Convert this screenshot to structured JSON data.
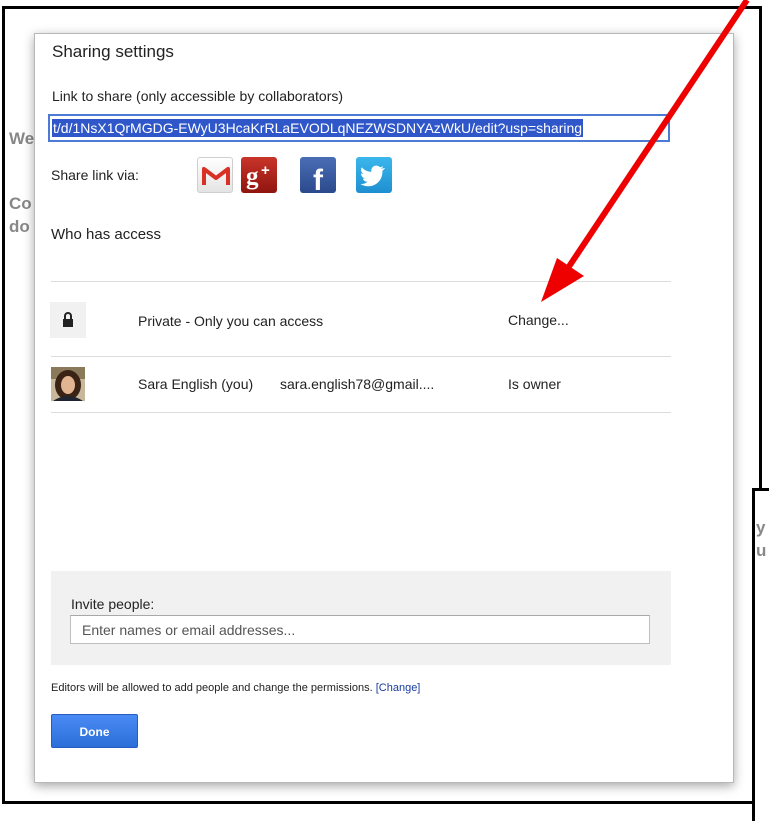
{
  "background": {
    "left_fragments": [
      "We",
      "Co",
      "do"
    ],
    "right_fragments": [
      "y",
      "u"
    ]
  },
  "dialog": {
    "title": "Sharing settings",
    "link_label": "Link to share (only accessible by collaborators)",
    "link_value": "t/d/1NsX1QrMGDG-EWyU3HcaKrRLaEVODLqNEZWSDNYAzWkU/edit?usp=sharing",
    "share_label": "Share link via:",
    "share_services": [
      {
        "name": "gmail-icon",
        "glyph": "M",
        "color": "#d93025"
      },
      {
        "name": "google-plus-icon",
        "glyph": "g+",
        "color": "#b3211a"
      },
      {
        "name": "facebook-icon",
        "glyph": "f",
        "color": "#3b5998"
      },
      {
        "name": "twitter-icon",
        "glyph": "🐦",
        "color": "#2aa9e0"
      }
    ],
    "who_has_access": "Who has access",
    "access_rows": [
      {
        "icon": "lock-icon",
        "label": "Private - Only you can access",
        "action": "Change..."
      },
      {
        "icon": "avatar",
        "label": "Sara English (you)",
        "email": "sara.english78@gmail....",
        "role": "Is owner"
      }
    ],
    "invite": {
      "label": "Invite people:",
      "placeholder": "Enter names or email addresses...",
      "value": ""
    },
    "editors_note": "Editors will be allowed to add people and change the permissions.",
    "editors_change_link": "[Change]",
    "done_label": "Done"
  },
  "colors": {
    "accent": "#2f57c9",
    "annotation_arrow": "#ee0000",
    "done_button": "#3a7ee8"
  }
}
